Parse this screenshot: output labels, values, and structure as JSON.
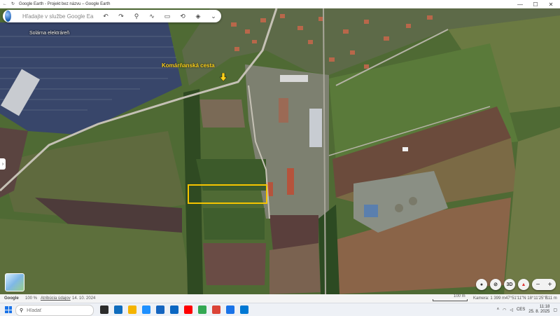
{
  "window": {
    "title": "Google Earth - Projekt bez názvu – Google Earth",
    "minimize": "—",
    "maximize": "☐",
    "close": "✕"
  },
  "search": {
    "placeholder": "Hľadajte v službe Google Earth",
    "tools": [
      "undo-icon",
      "redo-icon",
      "place-icon",
      "path-icon",
      "measure-icon",
      "history-icon",
      "layers-icon",
      "more-icon"
    ]
  },
  "map": {
    "layer_label": "Solárna elektráreň",
    "road_label": "Komárňanská cesta",
    "highlight_color": "#f5c400",
    "label_color": "#ffd21a"
  },
  "controls": {
    "view_3d": "3D",
    "zoom_out": "−",
    "zoom_in": "+"
  },
  "status": {
    "brand": "Google",
    "zoom": "100 %",
    "attribution": "Atribúcia údajov",
    "date": "14. 10. 2024",
    "scale": "100 m",
    "camera": "Kamera: 1 399 m",
    "coords": "47°51'11\"N 18°11'25\"E",
    "elevation": "111 m"
  },
  "taskbar": {
    "search_placeholder": "Hľadať",
    "lang": "CES",
    "time": "11:18",
    "date": "25. 8. 2025",
    "apps": [
      "#2b2b2b",
      "#0f6cbd",
      "#f5b400",
      "#1e90ff",
      "#1565c0",
      "#0a66c2",
      "#ff0000",
      "#34a853",
      "#db4437",
      "#1a73e8",
      "#0078d4"
    ]
  }
}
